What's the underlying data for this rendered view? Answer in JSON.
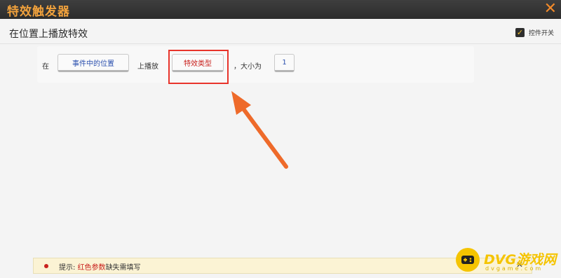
{
  "window": {
    "title": "特效触发器",
    "close_icon": "close-x-icon",
    "accent_color": "#f2a23c"
  },
  "action": {
    "title": "在位置上播放特效",
    "toggle": {
      "label": "控件开关",
      "checked": true
    }
  },
  "rule": {
    "word_at": "在",
    "position_param": "事件中的位置",
    "word_play": "上播放",
    "effect_param": "特效类型",
    "word_size": "，大小为",
    "size_param": "1"
  },
  "annotation": {
    "highlight_color": "#e8342b",
    "arrow_color": "#ee6a2a"
  },
  "tip": {
    "prefix": "提示: ",
    "highlight": "红色参数",
    "suffix": "缺失需填写",
    "close_icon": "close-icon"
  },
  "watermark": {
    "text": "DVG游戏网",
    "url": "dvgame.com"
  }
}
